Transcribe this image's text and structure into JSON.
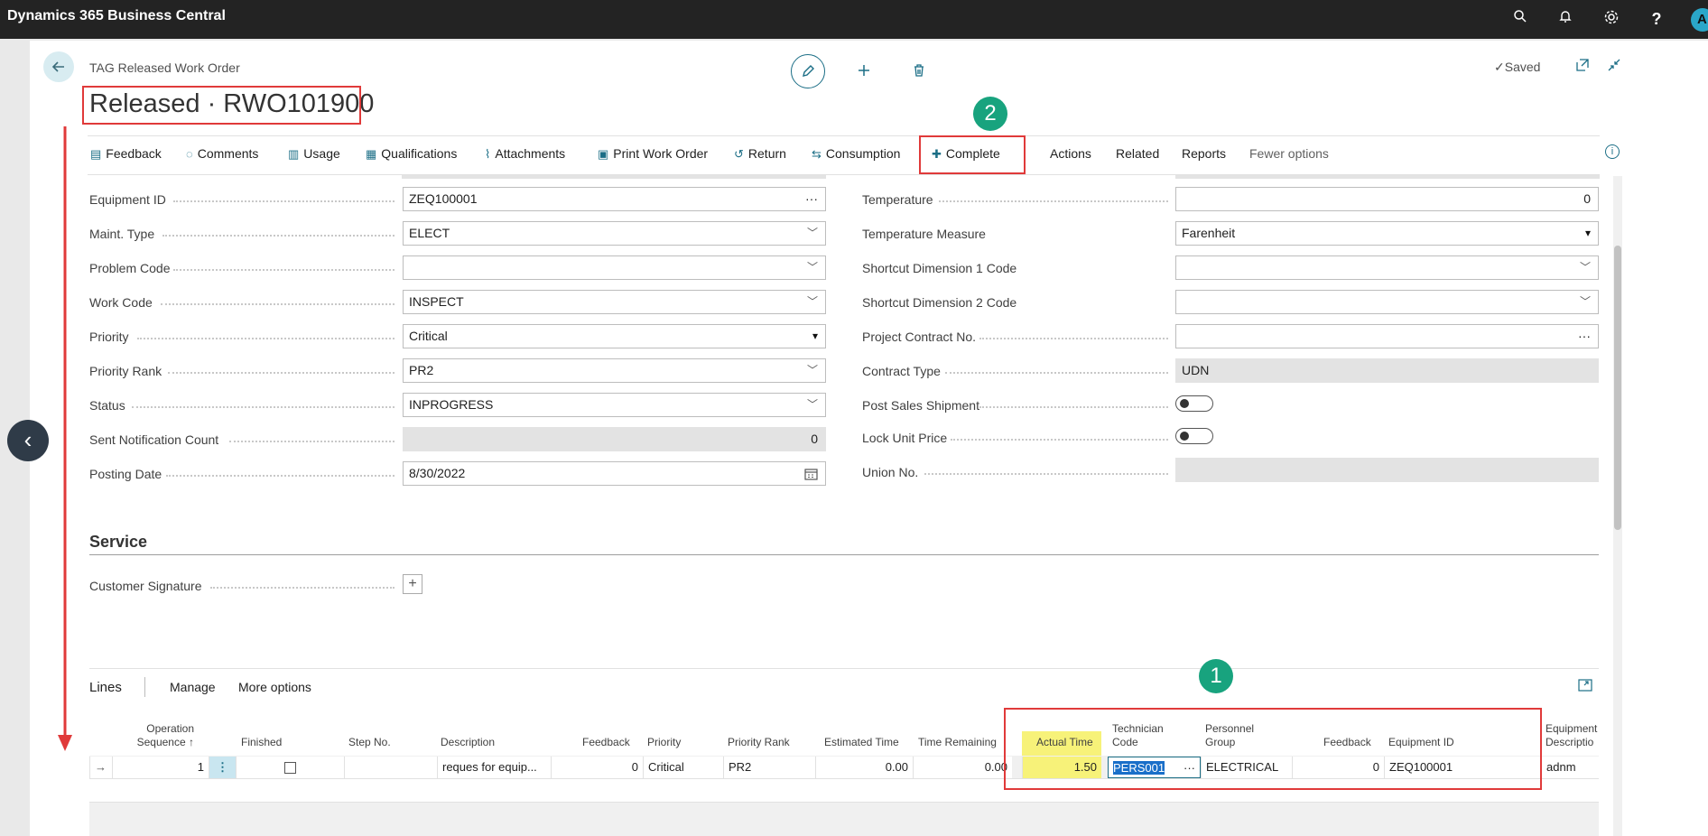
{
  "app": {
    "title": "Dynamics 365 Business Central",
    "avatar_initial": "A",
    "icons": [
      "search-icon",
      "bell-icon",
      "gear-icon",
      "help-icon"
    ]
  },
  "header": {
    "breadcrumb": "TAG Released Work Order",
    "title": "Released · RWO101900",
    "saved_label": "Saved",
    "badge_2": "2",
    "badge_1": "1"
  },
  "actions": [
    {
      "label": "Feedback",
      "icon": "feedback-icon"
    },
    {
      "label": "Comments",
      "icon": "comments-icon"
    },
    {
      "label": "Usage",
      "icon": "usage-icon"
    },
    {
      "label": "Qualifications",
      "icon": "qualifications-icon"
    },
    {
      "label": "Attachments",
      "icon": "attachments-icon"
    },
    {
      "label": "Print Work Order",
      "icon": "print-icon"
    },
    {
      "label": "Return",
      "icon": "return-icon"
    },
    {
      "label": "Consumption",
      "icon": "consumption-icon"
    },
    {
      "label": "Complete",
      "icon": "complete-icon"
    },
    {
      "label": "Actions"
    },
    {
      "label": "Related"
    },
    {
      "label": "Reports"
    },
    {
      "label": "Fewer options"
    }
  ],
  "left_fields": [
    {
      "label": "Equipment ID",
      "value": "ZEQ100001",
      "kind": "lookup"
    },
    {
      "label": "Maint. Type",
      "value": "ELECT",
      "kind": "dropdown"
    },
    {
      "label": "Problem Code",
      "value": "",
      "kind": "dropdown"
    },
    {
      "label": "Work Code",
      "value": "INSPECT",
      "kind": "dropdown"
    },
    {
      "label": "Priority",
      "value": "Critical",
      "kind": "select"
    },
    {
      "label": "Priority Rank",
      "value": "PR2",
      "kind": "dropdown"
    },
    {
      "label": "Status",
      "value": "INPROGRESS",
      "kind": "dropdown"
    },
    {
      "label": "Sent Notification Count",
      "value": "0",
      "kind": "readonly"
    },
    {
      "label": "Posting Date",
      "value": "8/30/2022",
      "kind": "date"
    }
  ],
  "right_fields": [
    {
      "label": "Temperature",
      "value": "0",
      "kind": "number"
    },
    {
      "label": "Temperature Measure",
      "value": "Farenheit",
      "kind": "select"
    },
    {
      "label": "Shortcut Dimension 1 Code",
      "value": "",
      "kind": "dropdown"
    },
    {
      "label": "Shortcut Dimension 2 Code",
      "value": "",
      "kind": "dropdown"
    },
    {
      "label": "Project Contract No.",
      "value": "",
      "kind": "lookup"
    },
    {
      "label": "Contract Type",
      "value": "UDN",
      "kind": "readonly"
    },
    {
      "label": "Post Sales Shipment",
      "value": "",
      "kind": "toggle"
    },
    {
      "label": "Lock Unit Price",
      "value": "",
      "kind": "toggle"
    },
    {
      "label": "Union No.",
      "value": "",
      "kind": "readonly"
    }
  ],
  "service": {
    "title": "Service",
    "signature_label": "Customer Signature"
  },
  "lines": {
    "title": "Lines",
    "manage": "Manage",
    "more": "More options",
    "headers": {
      "op_seq_1": "Operation",
      "op_seq_2": "Sequence ↑",
      "finished": "Finished",
      "step": "Step No.",
      "description": "Description",
      "feedback": "Feedback",
      "priority": "Priority",
      "priority_rank": "Priority Rank",
      "est_time": "Estimated Time",
      "time_remaining": "Time Remaining",
      "actual_time": "Actual Time",
      "tech_1": "Technician",
      "tech_2": "Code",
      "pg_1": "Personnel",
      "pg_2": "Group",
      "feedback2": "Feedback",
      "equip_id": "Equipment ID",
      "equip_desc_1": "Equipment",
      "equip_desc_2": "Descriptio"
    },
    "row": {
      "op_seq": "1",
      "step": "",
      "description": "reques for equip...",
      "feedback": "0",
      "priority": "Critical",
      "priority_rank": "PR2",
      "est_time": "0.00",
      "time_remaining": "0.00",
      "actual_time": "1.50",
      "tech_code": "PERS001",
      "personnel_group": "ELECTRICAL",
      "feedback2": "0",
      "equip_id": "ZEQ100001",
      "equip_desc": "adnm"
    }
  }
}
